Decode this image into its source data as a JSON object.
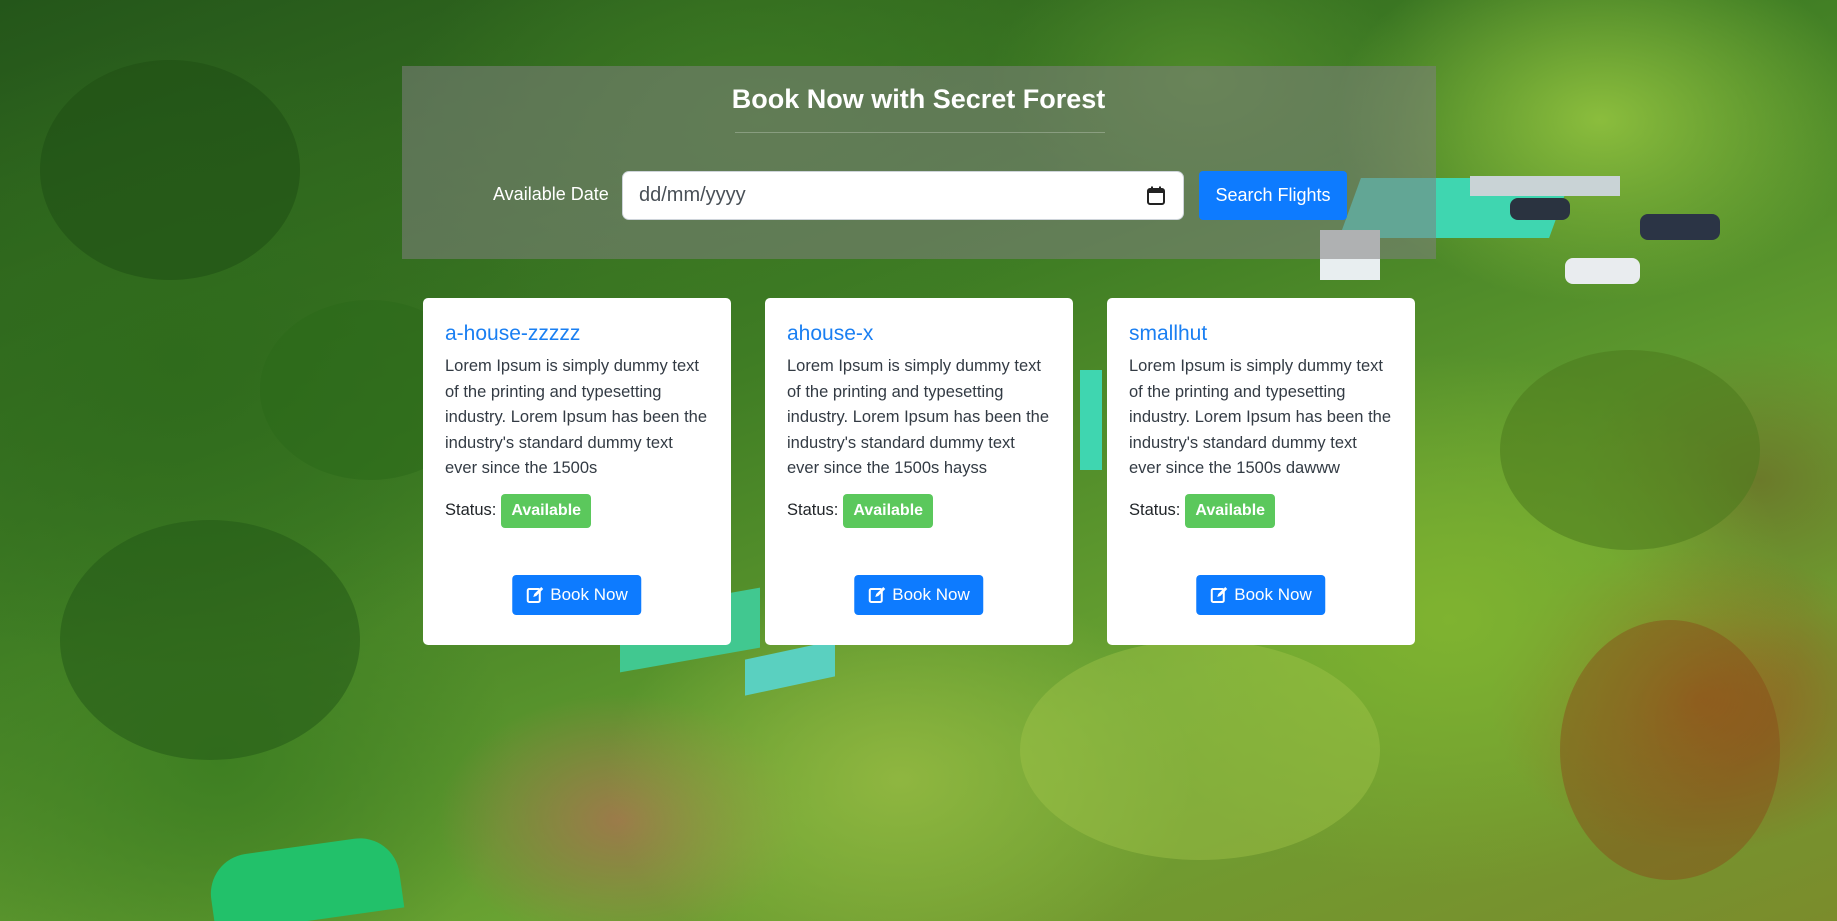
{
  "header": {
    "title": "Book Now with Secret Forest",
    "date_label": "Available Date",
    "date_placeholder": "dd/mm/yyyy",
    "search_label": "Search Flights"
  },
  "cards": [
    {
      "name": "a-house-zzzzz",
      "description": "Lorem Ipsum is simply dummy text of the printing and typesetting industry. Lorem Ipsum has been the industry's standard dummy text ever since the 1500s",
      "status_label": "Status:",
      "status": "Available",
      "button_label": "Book Now"
    },
    {
      "name": "ahouse-x",
      "description": "Lorem Ipsum is simply dummy text of the printing and typesetting industry. Lorem Ipsum has been the industry's standard dummy text ever since the 1500s hayss",
      "status_label": "Status:",
      "status": "Available",
      "button_label": "Book Now"
    },
    {
      "name": "smallhut",
      "description": "Lorem Ipsum is simply dummy text of the printing and typesetting industry. Lorem Ipsum has been the industry's standard dummy text ever since the 1500s dawww",
      "status_label": "Status:",
      "status": "Available",
      "button_label": "Book Now"
    }
  ],
  "icons": {
    "calendar": "calendar-icon",
    "edit": "edit-icon"
  },
  "colors": {
    "primary": "#0d7bff",
    "success": "#5bc85c",
    "card_title": "#1a7ff2"
  }
}
